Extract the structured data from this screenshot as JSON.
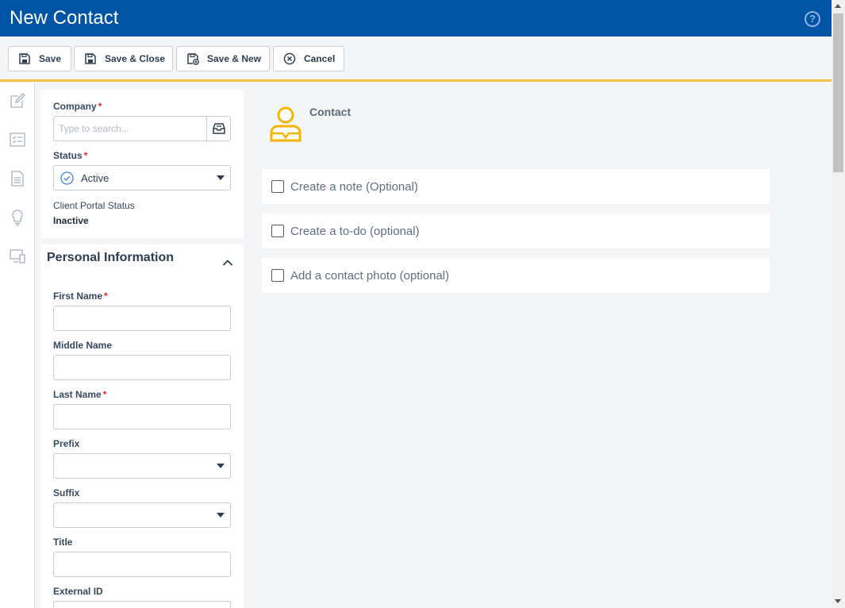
{
  "header": {
    "title": "New Contact",
    "help_icon": "help-circle-icon"
  },
  "toolbar": {
    "save": "Save",
    "save_close": "Save & Close",
    "save_new": "Save & New",
    "cancel": "Cancel"
  },
  "company_card": {
    "company_label": "Company",
    "company_placeholder": "Type to search...",
    "status_label": "Status",
    "status_value": "Active",
    "portal_label": "Client Portal Status",
    "portal_value": "Inactive"
  },
  "personal": {
    "title": "Personal Information",
    "first_name": "First Name",
    "middle_name": "Middle Name",
    "last_name": "Last Name",
    "prefix": "Prefix",
    "suffix": "Suffix",
    "title_label": "Title",
    "external_id": "External ID"
  },
  "main": {
    "contact_label": "Contact",
    "options": [
      "Create a note (Optional)",
      "Create a to-do (optional)",
      "Add a contact photo (optional)"
    ]
  },
  "required_marker": "*",
  "colors": {
    "header": "#0054a6",
    "accent": "#f5c142",
    "required": "#e0262d"
  }
}
